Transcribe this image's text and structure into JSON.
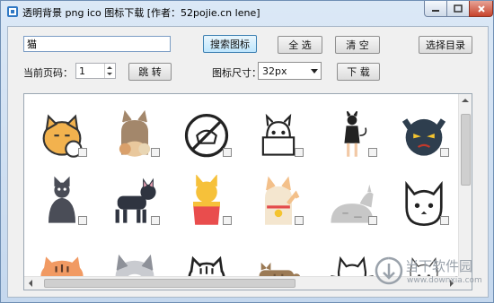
{
  "window": {
    "title": "透明背景 png ico 图标下载  [作者：52pojie.cn lene]",
    "controls": [
      "minimize-icon",
      "maximize-icon",
      "close-icon"
    ]
  },
  "search": {
    "value": "猫",
    "button": "搜索图标"
  },
  "toolbar": {
    "select_all": "全 选",
    "clear": "清 空",
    "choose_dir": "选择目录",
    "jump": "跳 转",
    "download": "下 载"
  },
  "page": {
    "label": "当前页码：",
    "value": "1"
  },
  "size": {
    "label": "图标尺寸：",
    "selected": "32px"
  },
  "icons": [
    {
      "name": "orange-fat-cat-icon"
    },
    {
      "name": "brown-cat-family-icon"
    },
    {
      "name": "no-cat-sign-icon"
    },
    {
      "name": "outline-cat-basket-icon"
    },
    {
      "name": "cat-costume-woman-icon"
    },
    {
      "name": "angry-dark-cat-face-icon"
    },
    {
      "name": "sitting-grey-cat-icon"
    },
    {
      "name": "standing-black-cat-icon"
    },
    {
      "name": "yellow-cat-in-bag-icon"
    },
    {
      "name": "lucky-cat-icon"
    },
    {
      "name": "sleeping-grey-cat-icon"
    },
    {
      "name": "outline-cat-face-icon"
    },
    {
      "name": "tiger-cat-face-icon"
    },
    {
      "name": "grey-cat-face-icon"
    },
    {
      "name": "striped-cat-face-icon"
    },
    {
      "name": "lying-tabby-cat-icon"
    },
    {
      "name": "whisker-cat-outline-icon"
    },
    {
      "name": "thin-cat-outline-icon"
    }
  ],
  "watermark": {
    "main": "当下软件园",
    "url": "www.downxia.com"
  },
  "colors": {
    "focus": "#3c7fb1",
    "close": "#c7432c",
    "frame": "#c5d8ee"
  }
}
